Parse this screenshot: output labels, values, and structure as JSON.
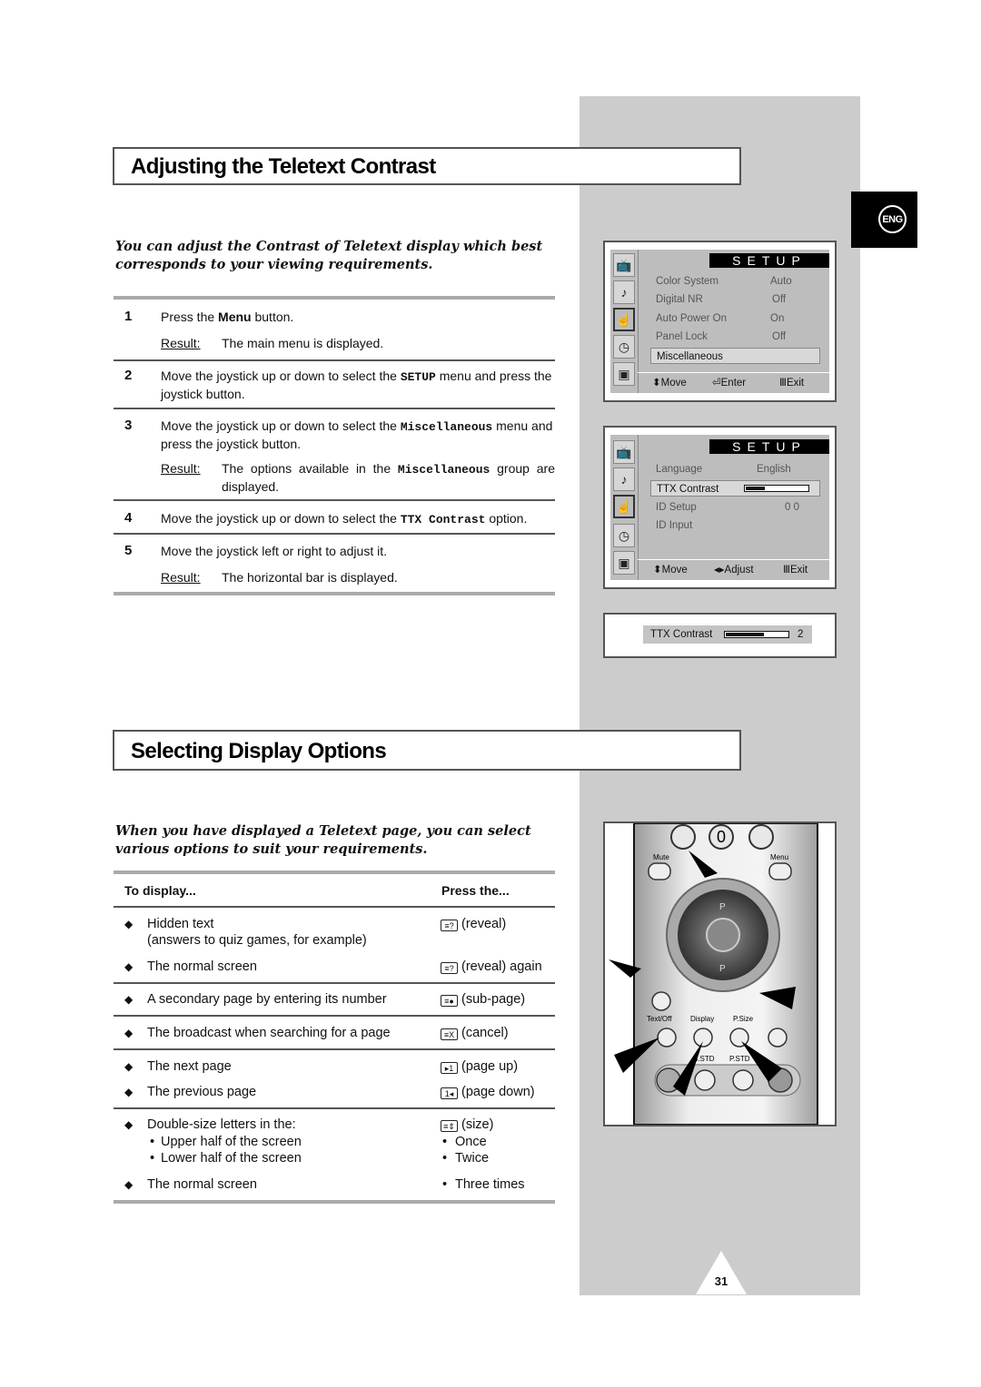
{
  "language_tab": "ENG",
  "section1": {
    "title": "Adjusting the Teletext Contrast",
    "intro": "You can adjust the Contrast of Teletext display which best corresponds to your viewing requirements.",
    "steps": [
      {
        "num": "1",
        "text_pre": "Press the ",
        "text_bold": "Menu",
        "text_post": " button.",
        "result_label": "Result:",
        "result": "The main menu is displayed."
      },
      {
        "num": "2",
        "text_pre": "Move the joystick up or down to select the ",
        "text_code": "SETUP",
        "text_post": " menu and press the joystick button."
      },
      {
        "num": "3",
        "text_pre": "Move the joystick up or down to select the ",
        "text_code": "Miscellaneous",
        "text_post": " menu and press the joystick button.",
        "result_label": "Result:",
        "result_pre": "The options available in the ",
        "result_code": "Miscellaneous",
        "result_post": " group are displayed."
      },
      {
        "num": "4",
        "text_pre": "Move the joystick up or down to select the ",
        "text_code": "TTX Contrast",
        "text_post": " option."
      },
      {
        "num": "5",
        "text_pre": "Move the joystick left or right to adjust it.",
        "result_label": "Result:",
        "result": "The horizontal bar is displayed."
      }
    ]
  },
  "osd1": {
    "header": "SETUP",
    "rows": [
      {
        "label": "Color System",
        "value": "Auto"
      },
      {
        "label": "Digital NR",
        "value": "Off"
      },
      {
        "label": "Auto Power On",
        "value": "On"
      },
      {
        "label": "Panel Lock",
        "value": "Off"
      },
      {
        "label": "Miscellaneous",
        "value": ""
      }
    ],
    "footer": {
      "move": "Move",
      "enter": "Enter",
      "exit": "Exit"
    }
  },
  "osd2": {
    "header": "SETUP",
    "rows": [
      {
        "label": "Language",
        "value": "English"
      },
      {
        "label": "TTX Contrast",
        "value": ""
      },
      {
        "label": "ID Setup",
        "value": "0 0"
      },
      {
        "label": "ID Input",
        "value": ""
      }
    ],
    "ttx_contrast_level": 0.3,
    "footer": {
      "move": "Move",
      "adjust": "Adjust",
      "exit": "Exit"
    }
  },
  "osd3": {
    "label": "TTX Contrast",
    "value": "2",
    "level": 0.6
  },
  "section2": {
    "title": "Selecting Display Options",
    "intro": "When you have displayed a Teletext page, you can select various options to suit your requirements.",
    "table": {
      "col1": "To display...",
      "col2": "Press the...",
      "rows": [
        {
          "display": "Hidden text",
          "display2": "(answers to quiz games, for example)",
          "icon": "?",
          "press": "(reveal)"
        },
        {
          "display": "The normal screen",
          "icon": "?",
          "press": "(reveal) again"
        },
        {
          "display": "A secondary page by entering its number",
          "icon": "●",
          "press": "(sub-page)"
        },
        {
          "display": "The broadcast when searching for a page",
          "icon": "X",
          "press": "(cancel)"
        },
        {
          "display": "The next page",
          "icon": "▸1",
          "press": "(page up)"
        },
        {
          "display": "The previous page",
          "icon": "1◂",
          "press": "(page down)"
        },
        {
          "display": "Double-size letters in the:",
          "icon": "⇕",
          "press": "(size)",
          "subs": [
            {
              "display": "Upper half of the screen",
              "press": "Once"
            },
            {
              "display": "Lower half of the screen",
              "press": "Twice"
            }
          ]
        },
        {
          "display": "The normal screen",
          "press_bullet": "Three times"
        }
      ]
    }
  },
  "remote": {
    "labels": {
      "mute": "Mute",
      "menu": "Menu",
      "text_off": "Text/Off",
      "display": "Display",
      "p_size": "P.Size",
      "s_std": "S.STD",
      "p_std": "P.STD",
      "zero": "0",
      "p": "P"
    }
  },
  "page_number": "31"
}
